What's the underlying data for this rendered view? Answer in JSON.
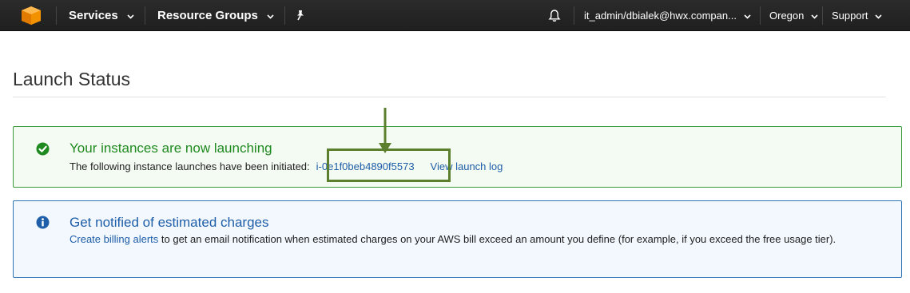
{
  "nav": {
    "logo": "aws-cube-logo",
    "services_label": "Services",
    "resource_groups_label": "Resource Groups",
    "pin_icon": "pin-icon",
    "bell_icon": "bell-icon",
    "account_label": "it_admin/dbialek@hwx.compan...",
    "region_label": "Oregon",
    "support_label": "Support"
  },
  "page": {
    "title": "Launch Status"
  },
  "success_alert": {
    "icon": "check-circle-icon",
    "heading": "Your instances are now launching",
    "body_text": "The following instance launches have been initiated:",
    "instance_id": "i-0e1f0beb4890f5573",
    "view_log_label": "View launch log",
    "color": "#1f8a1f"
  },
  "info_alert": {
    "icon": "info-circle-icon",
    "heading": "Get notified of estimated charges",
    "billing_link": "Create billing alerts",
    "body_text": " to get an email notification when estimated charges on your AWS bill exceed an amount you define (for example, if you exceed the free usage tier).",
    "color": "#1f5ea8"
  },
  "annotation": {
    "color": "#5b7f2d",
    "highlight": "instance-id-highlight",
    "arrow": "pointer-arrow"
  }
}
